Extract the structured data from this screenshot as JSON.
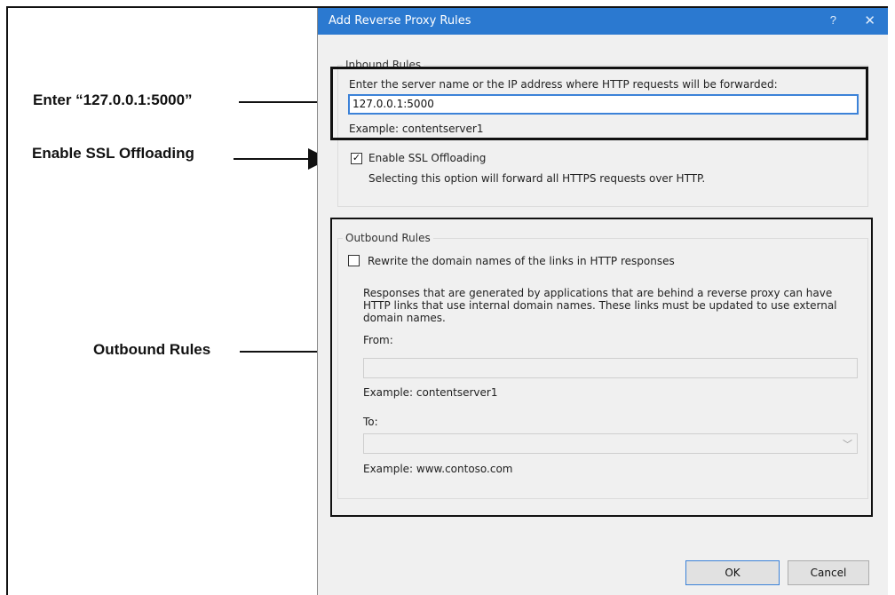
{
  "callouts": {
    "enter_address": "Enter “127.0.0.1:5000”",
    "enable_ssl": "Enable SSL Offloading",
    "outbound": "Outbound Rules"
  },
  "dialog": {
    "title": "Add Reverse Proxy Rules",
    "help_glyph": "?",
    "close_glyph": "✕",
    "inbound": {
      "legend": "Inbound Rules",
      "instruction": "Enter the server name or the IP address where HTTP requests will be forwarded:",
      "server_value": "127.0.0.1:5000",
      "example": "Example: contentserver1",
      "ssl_checked": true,
      "ssl_label": "Enable SSL Offloading",
      "ssl_desc": "Selecting this option will forward all HTTPS requests over HTTP."
    },
    "outbound": {
      "legend": "Outbound Rules",
      "rewrite_checked": false,
      "rewrite_label": "Rewrite the domain names of the links in HTTP responses",
      "desc_line1": "Responses that are generated by applications that are behind a reverse proxy can have",
      "desc_line2": "HTTP links that use internal domain names. These links must be updated to use external",
      "desc_line3": "domain names.",
      "from_label": "From:",
      "from_value": "",
      "from_example": "Example: contentserver1",
      "to_label": "To:",
      "to_value": "",
      "to_example": "Example: www.contoso.com"
    },
    "ok_label": "OK",
    "cancel_label": "Cancel"
  },
  "icons": {
    "checkmark": "✓",
    "chevron": "﹀"
  },
  "colors": {
    "titlebar": "#2b79d0",
    "focus": "#3c82d8",
    "dialog_bg": "#f0f0f0"
  }
}
